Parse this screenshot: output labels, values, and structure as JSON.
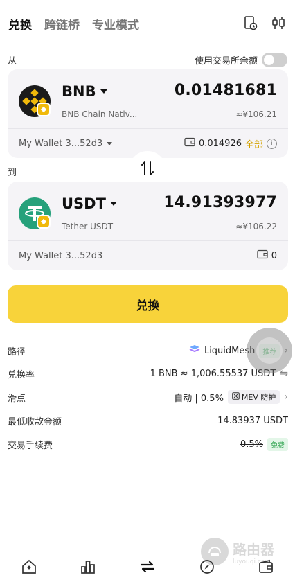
{
  "tabs": [
    {
      "label": "兑换"
    },
    {
      "label": "跨链桥"
    },
    {
      "label": "专业模式"
    }
  ],
  "labels": {
    "from": "从",
    "to": "到",
    "use_exchange_balance": "使用交易所余额"
  },
  "from_token": {
    "symbol": "BNB",
    "chain": "BNB Chain Nativ...",
    "amount": "0.01481681",
    "fiat": "≈¥106.21",
    "wallet": "My Wallet 3...52d3",
    "balance": "0.014926",
    "max_label": "全部",
    "info_glyph": "i"
  },
  "to_token": {
    "symbol": "USDT",
    "chain": "Tether USDT",
    "amount": "14.91393977",
    "fiat": "≈¥106.22",
    "wallet": "My Wallet 3...52d3",
    "balance": "0"
  },
  "action": {
    "primary_label": "兑换"
  },
  "details": {
    "route_label": "路径",
    "route_value": "LiquidMesh",
    "route_tag": "推荐",
    "rate_label": "兑换率",
    "rate_value": "1 BNB ≈ 1,006.55537 USDT",
    "slippage_label": "滑点",
    "slippage_value": "自动 | 0.5%",
    "mev_label": "MEV 防护",
    "min_receive_label": "最低收款金额",
    "min_receive_value": "14.83937 USDT",
    "fee_label": "交易手续费",
    "fee_old": "0.5%",
    "fee_tag": "免费"
  },
  "watermark": {
    "text": "路由器",
    "sub": "luyouqi.com"
  },
  "colors": {
    "accent_yellow": "#f8d33a",
    "bnb_gold": "#f0b90b",
    "usdt_green": "#26a17b",
    "free_green": "#2fa44f"
  },
  "icons": [
    "history-icon",
    "settings-sliders-icon",
    "swap-direction-icon",
    "wallet-icon",
    "home-icon",
    "market-icon",
    "trade-icon",
    "discover-icon",
    "assets-icon"
  ]
}
